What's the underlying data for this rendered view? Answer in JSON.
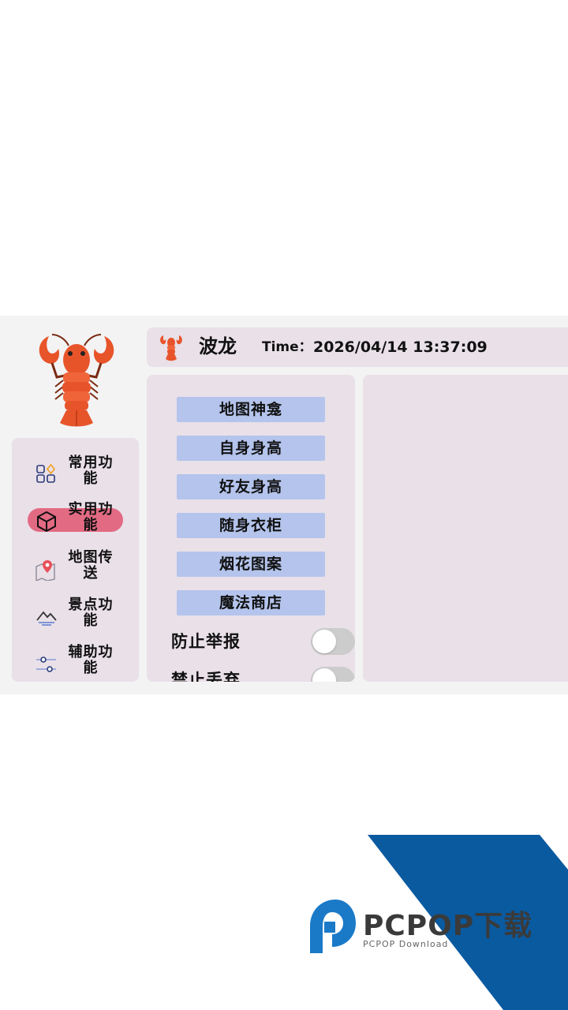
{
  "header": {
    "app_name": "波龙",
    "time_label": "Time：",
    "time_value": "2026/04/14 13:37:09"
  },
  "sidebar": {
    "items": [
      {
        "label": "常用功能",
        "icon": "apps-icon",
        "active": false
      },
      {
        "label": "实用功能",
        "icon": "cube-icon",
        "active": true
      },
      {
        "label": "地图传送",
        "icon": "map-pin-icon",
        "active": false
      },
      {
        "label": "景点功能",
        "icon": "mountain-icon",
        "active": false
      },
      {
        "label": "辅助功能",
        "icon": "sliders-icon",
        "active": false
      }
    ]
  },
  "main": {
    "buttons": [
      {
        "label": "地图神龛"
      },
      {
        "label": "自身身高"
      },
      {
        "label": "好友身高"
      },
      {
        "label": "随身衣柜"
      },
      {
        "label": "烟花图案"
      },
      {
        "label": "魔法商店"
      }
    ],
    "toggles": [
      {
        "label": "防止举报",
        "on": false
      },
      {
        "label": "禁止丢弃",
        "on": false
      }
    ]
  },
  "watermark": {
    "title": "PCPOP下载",
    "subtitle": "PCPOP Download"
  },
  "colors": {
    "panel": "#e9e0e8",
    "active_nav": "#e36a83",
    "button": "#b4c4ec",
    "toggle_off": "#cccccc",
    "lobster": "#e8542a",
    "watermark_blue": "#0a5aa0"
  }
}
